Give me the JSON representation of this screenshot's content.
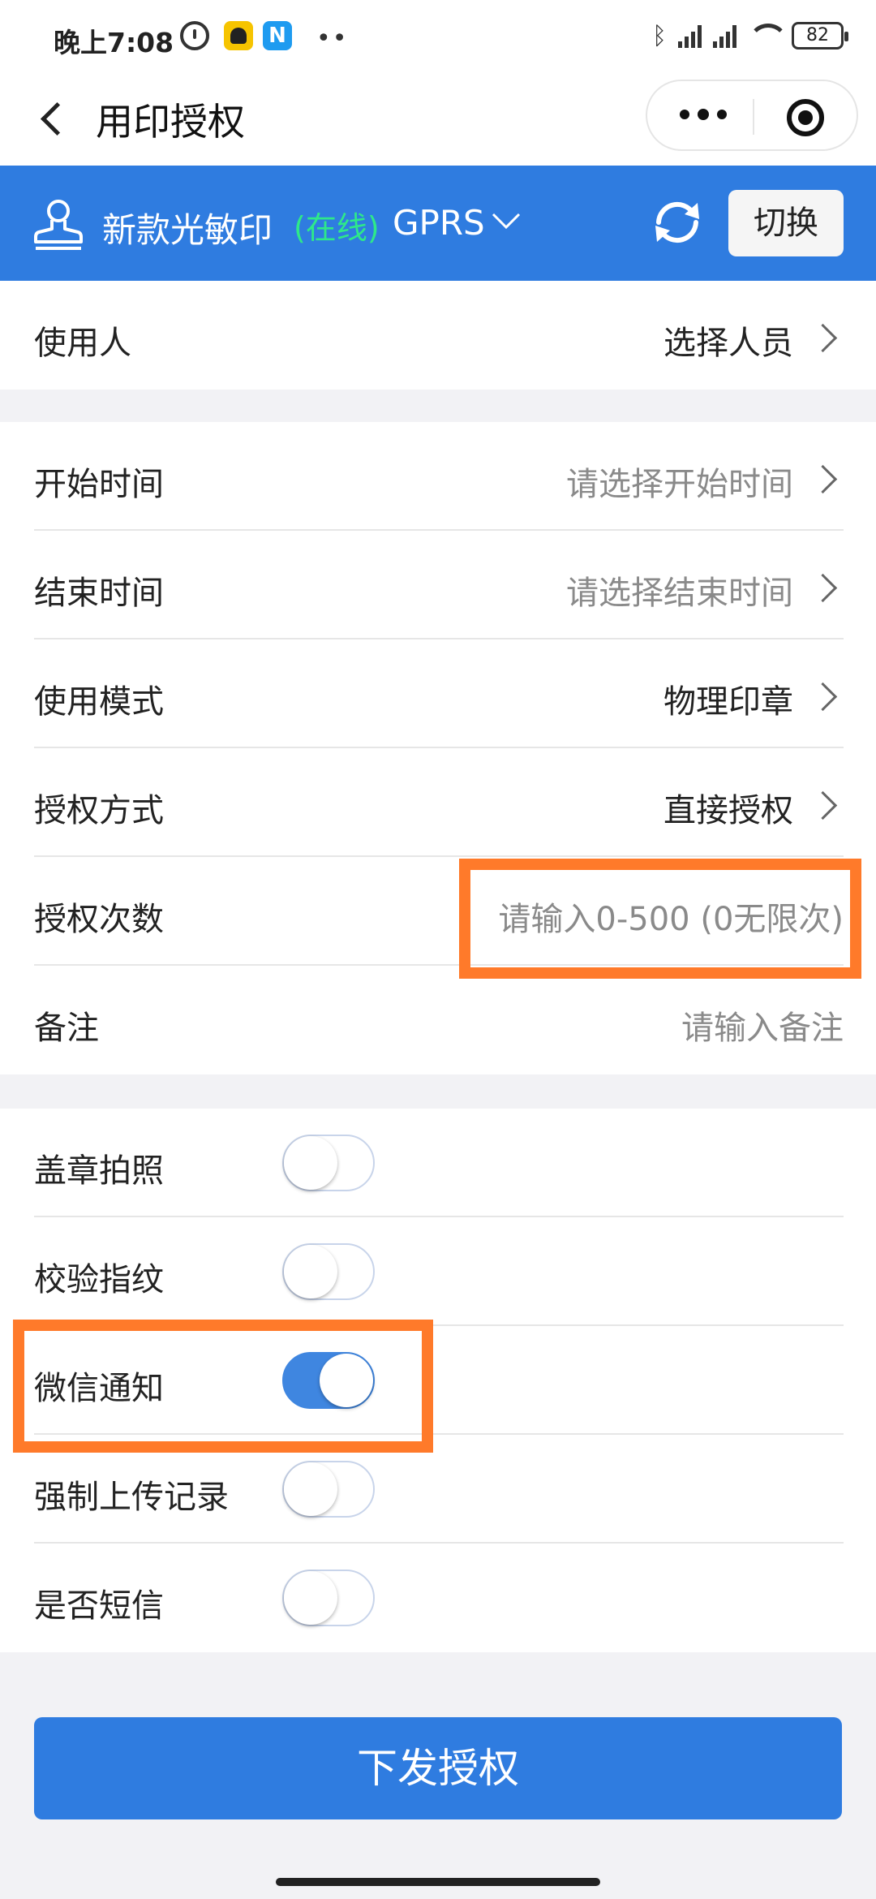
{
  "status_bar": {
    "time": "晚上7:08",
    "battery": "82",
    "app2_letter": "N"
  },
  "nav": {
    "title": "用印授权"
  },
  "device": {
    "name": "新款光敏印",
    "status": "(在线)",
    "connection": "GPRS",
    "switch_label": "切换",
    "status_color": "#2ee88a",
    "header_color": "#2f7ce0"
  },
  "user_section": {
    "user_label": "使用人",
    "user_value": "选择人员"
  },
  "form": {
    "start_label": "开始时间",
    "start_placeholder": "请选择开始时间",
    "end_label": "结束时间",
    "end_placeholder": "请选择结束时间",
    "mode_label": "使用模式",
    "mode_value": "物理印章",
    "method_label": "授权方式",
    "method_value": "直接授权",
    "count_label": "授权次数",
    "count_placeholder": "请输入0-500 (0无限次)",
    "remark_label": "备注",
    "remark_placeholder": "请输入备注"
  },
  "toggles": [
    {
      "label": "盖章拍照",
      "on": false
    },
    {
      "label": "校验指纹",
      "on": false
    },
    {
      "label": "微信通知",
      "on": true
    },
    {
      "label": "强制上传记录",
      "on": false
    },
    {
      "label": "是否短信",
      "on": false
    }
  ],
  "submit_label": "下发授权",
  "highlight_color": "#ff7a2a"
}
